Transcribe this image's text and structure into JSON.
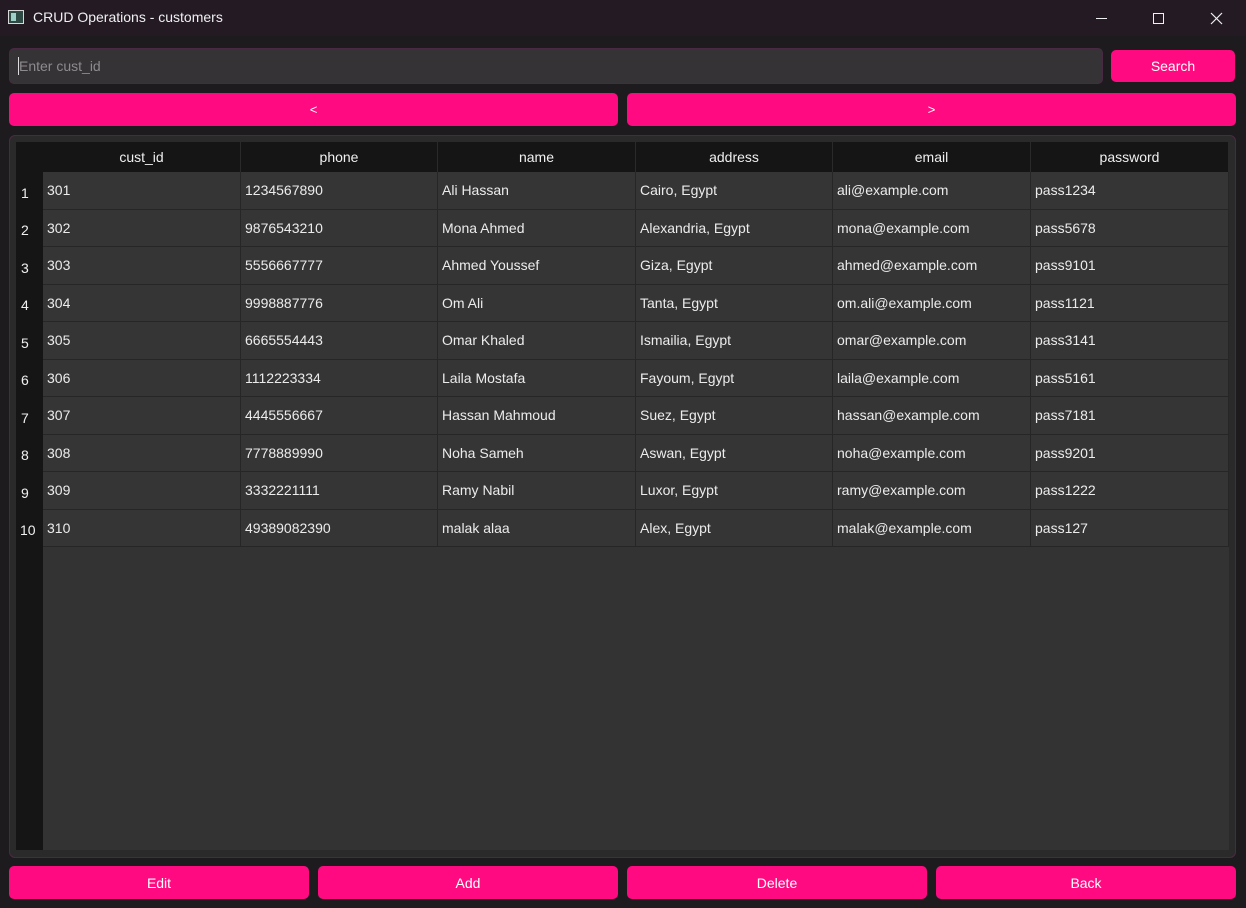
{
  "window": {
    "title": "CRUD Operations - customers",
    "minimize": "—",
    "maximize": "☐",
    "close": "✕"
  },
  "search": {
    "placeholder": "Enter cust_id",
    "value": "",
    "button_label": "Search"
  },
  "pagination": {
    "prev_label": "<",
    "next_label": ">"
  },
  "table": {
    "columns": [
      "cust_id",
      "phone",
      "name",
      "address",
      "email",
      "password"
    ],
    "rows": [
      {
        "num": "1",
        "cells": [
          "301",
          "1234567890",
          "Ali Hassan",
          "Cairo, Egypt",
          "ali@example.com",
          "pass1234"
        ]
      },
      {
        "num": "2",
        "cells": [
          "302",
          "9876543210",
          "Mona Ahmed",
          "Alexandria, Egypt",
          "mona@example.com",
          "pass5678"
        ]
      },
      {
        "num": "3",
        "cells": [
          "303",
          "5556667777",
          "Ahmed Youssef",
          "Giza, Egypt",
          "ahmed@example.com",
          "pass9101"
        ]
      },
      {
        "num": "4",
        "cells": [
          "304",
          "9998887776",
          "Om Ali",
          "Tanta, Egypt",
          "om.ali@example.com",
          "pass1121"
        ]
      },
      {
        "num": "5",
        "cells": [
          "305",
          "6665554443",
          "Omar Khaled",
          "Ismailia, Egypt",
          "omar@example.com",
          "pass3141"
        ]
      },
      {
        "num": "6",
        "cells": [
          "306",
          "1112223334",
          "Laila Mostafa",
          "Fayoum, Egypt",
          "laila@example.com",
          "pass5161"
        ]
      },
      {
        "num": "7",
        "cells": [
          "307",
          "4445556667",
          "Hassan Mahmoud",
          "Suez, Egypt",
          "hassan@example.com",
          "pass7181"
        ]
      },
      {
        "num": "8",
        "cells": [
          "308",
          "7778889990",
          "Noha Sameh",
          "Aswan, Egypt",
          "noha@example.com",
          "pass9201"
        ]
      },
      {
        "num": "9",
        "cells": [
          "309",
          "3332221111",
          "Ramy Nabil",
          "Luxor, Egypt",
          "ramy@example.com",
          "pass1222"
        ]
      },
      {
        "num": "10",
        "cells": [
          "310",
          "49389082390",
          "malak alaa",
          "Alex, Egypt",
          "malak@example.com",
          "pass127"
        ]
      }
    ]
  },
  "actions": {
    "edit_label": "Edit",
    "add_label": "Add",
    "delete_label": "Delete",
    "back_label": "Back"
  },
  "colors": {
    "accent": "#ff0a80",
    "background": "#1d1b1e",
    "table_bg": "#333333",
    "header_bg": "#151515"
  }
}
